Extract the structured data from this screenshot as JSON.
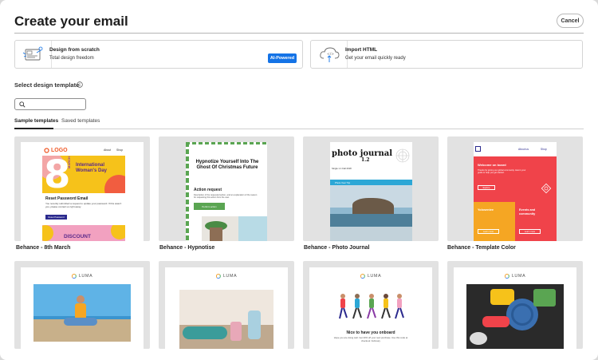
{
  "dialog": {
    "title": "Create your email",
    "cancel_label": "Cancel"
  },
  "options": {
    "scratch": {
      "title": "Design from scratch",
      "subtitle": "Total design freedom",
      "badge": "AI-Powered"
    },
    "import": {
      "title": "Import HTML",
      "subtitle": "Get your email quickly ready"
    }
  },
  "section": {
    "label": "Select design template"
  },
  "search": {
    "placeholder": "",
    "value": ""
  },
  "tabs": [
    {
      "label": "Sample templates",
      "active": true
    },
    {
      "label": "Saved templates",
      "active": false
    }
  ],
  "templates": [
    {
      "label": "Behance - 8th March",
      "email": {
        "logo": "LOGO",
        "nav1": "About",
        "nav2": "Shop",
        "big_number": "8",
        "month_vertical": "MARCH",
        "headline": "International Woman's Day",
        "section_title": "Reset Password Email",
        "body": "You recently submitted a request to update your password. If this wasn't you, please contact us right away.",
        "button": "Reset Password",
        "banner": "DISCOUNT"
      }
    },
    {
      "label": "Behance - Hypnotise",
      "email": {
        "headline": "Hypnotize Yourself Into The Ghost Of Christmas Future",
        "subhead": "Action request",
        "body": "Description of the requested action, and an explanation of the reason for requesting this action from the user.",
        "button": "Perform action"
      }
    },
    {
      "label": "Behance - Photo Journal",
      "email": {
        "title": "photo journal",
        "version": "1.2",
        "subtitle": "Single 1.1 Fall 2018",
        "bar_text": "Photo Year Trip"
      }
    },
    {
      "label": "Behance - Template Color",
      "email": {
        "nav1": "About us",
        "nav2": "Shop",
        "welcome": "Welcome on board",
        "intro": "Thanks for joining our global community. Here's your guide to help you get started.",
        "button1": "Explore",
        "tile1": "Yolosentee",
        "tile2": "Events and community",
        "button2": "Learn more",
        "button3": "Learn more"
      }
    },
    {
      "label": "",
      "email": {
        "brand": "LUMA"
      }
    },
    {
      "label": "",
      "email": {
        "brand": "LUMA"
      }
    },
    {
      "label": "",
      "email": {
        "brand": "LUMA",
        "headline": "Nice to have you onboard",
        "body": "Hope you are doing well. Get 20% off your next purchase. Use this code at checkout: February"
      }
    },
    {
      "label": "",
      "email": {
        "brand": "LUMA"
      }
    }
  ],
  "colors": {
    "accent": "#1473e6",
    "yellow": "#f6c21a",
    "red": "#f0434a",
    "pink": "#f2a1c0",
    "purple": "#8a3aa5",
    "green": "#5aa552",
    "cyan": "#2ca7d6",
    "orange": "#f5a623"
  }
}
